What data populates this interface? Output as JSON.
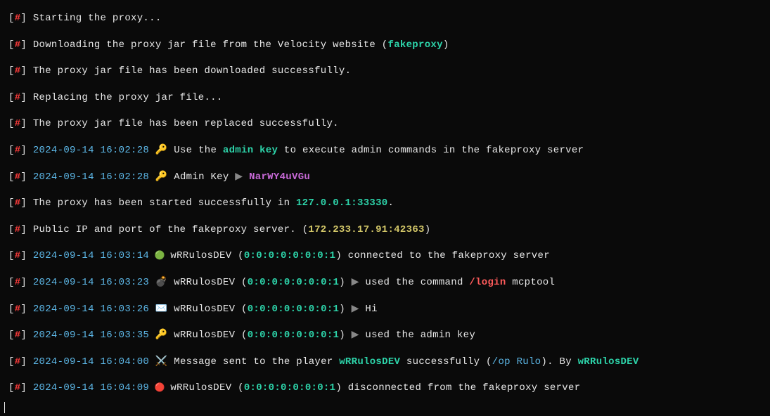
{
  "prefix": {
    "l": "[",
    "hash": "#",
    "r": "]"
  },
  "lines": {
    "l0": "Starting the proxy...",
    "l1a": "Downloading the proxy jar file from the Velocity website ",
    "l1p": "(",
    "l1b": "fakeproxy",
    "l1r": ")",
    "l2": "The proxy jar file has been downloaded successfully.",
    "l3": "Replacing the proxy jar file...",
    "l4": "The proxy jar file has been replaced successfully.",
    "l5ts": "2024-09-14 16:02:28",
    "l5a": " 🔑 Use the ",
    "l5b": "admin key",
    "l5c": " to execute admin commands in the fakeproxy server",
    "l6ts": "2024-09-14 16:02:28",
    "l6a": " 🔑 Admin Key ",
    "l6arr": "▶ ",
    "l6b": "NarWY4uVGu",
    "l7a": "The proxy has been started successfully in ",
    "l7b": "127.0.0.1:33330",
    "l7c": ".",
    "l8a": "Public IP and port of the fakeproxy server. ",
    "l8p": "(",
    "l8b": "172.233.17.91:42363",
    "l8r": ")",
    "l9ts": "2024-09-14 16:03:14",
    "l9dot": " 🟢 ",
    "l9u": "wRRulosDEV",
    "l9p1": " (",
    "l9ip": "0:0:0:0:0:0:0:1",
    "l9p2": ") ",
    "l9t": "connected to the fakeproxy server",
    "l10ts": "2024-09-14 16:03:23",
    "l10ic": " 💣 ",
    "l10u": "wRRulosDEV",
    "l10p1": " (",
    "l10ip": "0:0:0:0:0:0:0:1",
    "l10p2": ") ",
    "l10arr": "▶ ",
    "l10t": "used the command ",
    "l10c1": "/login ",
    "l10c2": "mcptool",
    "l11ts": "2024-09-14 16:03:26",
    "l11ic": " ✉️  ",
    "l11u": "wRRulosDEV",
    "l11p1": " (",
    "l11ip": "0:0:0:0:0:0:0:1",
    "l11p2": ") ",
    "l11arr": "▶ ",
    "l11t": "Hi",
    "l12ts": "2024-09-14 16:03:35",
    "l12ic": " 🔑 ",
    "l12u": "wRRulosDEV",
    "l12p1": " (",
    "l12ip": "0:0:0:0:0:0:0:1",
    "l12p2": ") ",
    "l12arr": "▶ ",
    "l12t": "used the admin key",
    "l13ts": "2024-09-14 16:04:00",
    "l13ic": " ⚔️  ",
    "l13a": "Message sent to the player ",
    "l13u": "wRRulosDEV",
    "l13b": " successfully (",
    "l13c": "/op Rulo",
    "l13d": "). By ",
    "l13u2": "wRRulosDEV",
    "l14ts": "2024-09-14 16:04:09",
    "l14dot": " 🔴 ",
    "l14u": "wRRulosDEV",
    "l14p1": " (",
    "l14ip": "0:0:0:0:0:0:0:1",
    "l14p2": ") ",
    "l14t": "disconnected from the fakeproxy server"
  }
}
